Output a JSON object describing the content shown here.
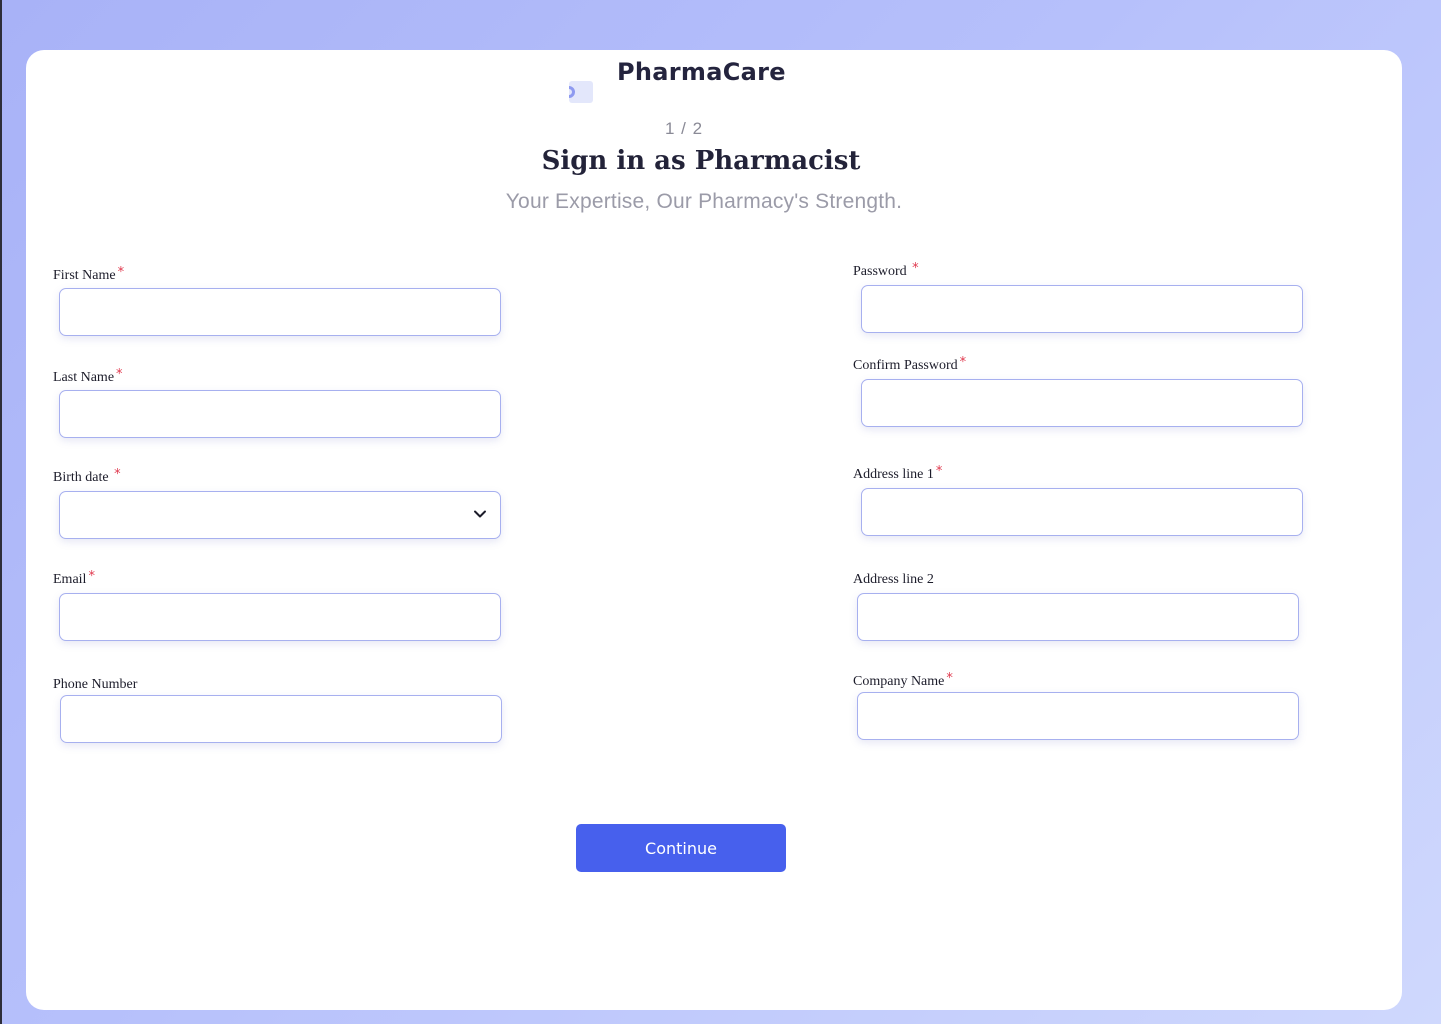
{
  "brand": {
    "name": "PharmaCare",
    "logo_icon": "pill-logo-icon"
  },
  "header": {
    "step": "1 / 2",
    "title": "Sign in as Pharmacist",
    "subtitle": "Your Expertise, Our Pharmacy's Strength."
  },
  "form": {
    "required_marker": "*",
    "left": {
      "first_name": {
        "label": "First Name",
        "value": ""
      },
      "last_name": {
        "label": "Last Name",
        "value": ""
      },
      "birth_date": {
        "label": "Birth date",
        "value": "",
        "icon": "chevron-down-icon"
      },
      "email": {
        "label": "Email",
        "value": ""
      },
      "phone": {
        "label": "Phone Number",
        "value": ""
      }
    },
    "right": {
      "password": {
        "label": "Password",
        "value": ""
      },
      "confirm_password": {
        "label": "Confirm Password",
        "value": ""
      },
      "address_1": {
        "label": "Address line 1",
        "value": ""
      },
      "address_2": {
        "label": "Address line 2",
        "value": ""
      },
      "company": {
        "label": "Company Name",
        "value": ""
      }
    }
  },
  "actions": {
    "continue_label": "Continue"
  },
  "colors": {
    "accent": "#4760ed",
    "required": "#e0384d",
    "input_border": "#a7b0ef",
    "background_start": "#a8b2f7",
    "background_end": "#cfd8fd"
  }
}
